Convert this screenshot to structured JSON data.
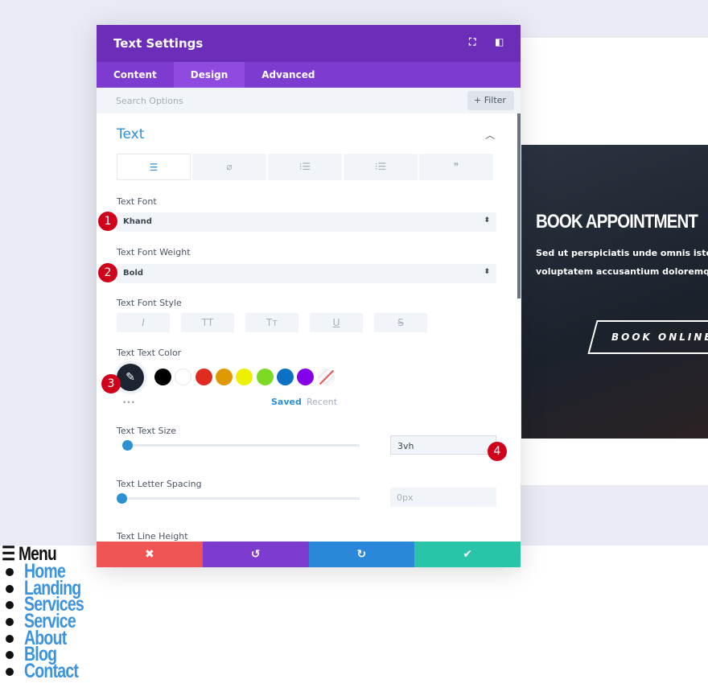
{
  "modal": {
    "title": "Text Settings",
    "tabs": [
      "Content",
      "Design",
      "Advanced"
    ],
    "active_tab": "Design",
    "search_placeholder": "Search Options",
    "filter_label": "+ Filter",
    "section_title": "Text",
    "text_font": {
      "label": "Text Font",
      "value": "Khand"
    },
    "text_font_weight": {
      "label": "Text Font Weight",
      "value": "Bold"
    },
    "text_font_style": {
      "label": "Text Font Style",
      "options": [
        "I",
        "TT",
        "Tт",
        "U",
        "S"
      ]
    },
    "text_color": {
      "label": "Text Text Color",
      "swatches": [
        "#000000",
        "#ffffff",
        "#e02b20",
        "#e09900",
        "#edf000",
        "#7cda24",
        "#0c71c3",
        "#8300e9"
      ],
      "saved": "Saved",
      "recent": "Recent",
      "more": "•••"
    },
    "text_size": {
      "label": "Text Text Size",
      "value": "3vh"
    },
    "letter_spacing": {
      "label": "Text Letter Spacing",
      "value": "0px"
    },
    "line_height": {
      "label": "Text Line Height"
    },
    "footer": {
      "cancel": "✖",
      "undo": "↺",
      "redo": "↻",
      "save": "✔",
      "colors": [
        "#ef5555",
        "#7e3bd0",
        "#2b87da",
        "#29c4a9"
      ]
    }
  },
  "badges": [
    "1",
    "2",
    "3",
    "4"
  ],
  "hero": {
    "title": "BOOK APPOINTMENT",
    "line1": "Sed ut perspiciatis unde omnis iste nat",
    "line2": "voluptatem accusantium doloremque l",
    "button": "BOOK ONLINE ▸"
  },
  "menu": {
    "icon": "☰",
    "title": "Menu",
    "items": [
      "Home",
      "Landing",
      "Services",
      "Service",
      "About",
      "Blog",
      "Contact"
    ]
  }
}
